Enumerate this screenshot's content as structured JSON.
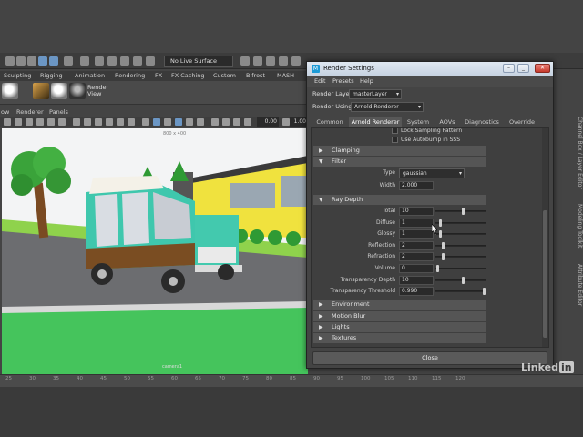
{
  "toolbar": {
    "surface_field": "No Live Surface"
  },
  "shelf": {
    "tabs": [
      "Sculpting",
      "Rigging",
      "Animation",
      "Rendering",
      "FX",
      "FX Caching",
      "Custom",
      "Bifrost",
      "MASH"
    ],
    "render_view_label": "Render View"
  },
  "panel_menu": [
    "ow",
    "Renderer",
    "Panels"
  ],
  "panel_fields": {
    "near": "0.00",
    "far": "1.00"
  },
  "viewport": {
    "resolution_gate": "800 x 400",
    "camera_label": "camera1"
  },
  "timeline": {
    "ticks": [
      "25",
      "30",
      "35",
      "40",
      "45",
      "50",
      "55",
      "60",
      "65",
      "70",
      "75",
      "80",
      "85",
      "90",
      "95",
      "100",
      "105",
      "110",
      "115",
      "120"
    ]
  },
  "side_tabs": [
    "Channel Box / Layer Editor",
    "Modeling Toolkit",
    "Attribute Editor"
  ],
  "render_settings": {
    "title": "Render Settings",
    "menus": [
      "Edit",
      "Presets",
      "Help"
    ],
    "render_layer_label": "Render Layer",
    "render_layer_value": "masterLayer",
    "render_using_label": "Render Using",
    "render_using_value": "Arnold Renderer",
    "tabs": [
      "Common",
      "Arnold Renderer",
      "System",
      "AOVs",
      "Diagnostics",
      "Override"
    ],
    "active_tab": "Arnold Renderer",
    "checkboxes": [
      "Lock Sampling Pattern",
      "Use Autobump in SSS"
    ],
    "sections": {
      "clamping": "Clamping",
      "filter": "Filter",
      "ray_depth": "Ray Depth",
      "environment": "Environment",
      "motion_blur": "Motion Blur",
      "lights": "Lights",
      "textures": "Textures"
    },
    "filter": {
      "type_label": "Type",
      "type_value": "gaussian",
      "width_label": "Width",
      "width_value": "2.000"
    },
    "ray_depth": [
      {
        "label": "Total",
        "value": "10",
        "level": 0.55
      },
      {
        "label": "Diffuse",
        "value": "1",
        "level": 0.08
      },
      {
        "label": "Glossy",
        "value": "1",
        "level": 0.08
      },
      {
        "label": "Reflection",
        "value": "2",
        "level": 0.14
      },
      {
        "label": "Refraction",
        "value": "2",
        "level": 0.14
      },
      {
        "label": "Volume",
        "value": "0",
        "level": 0.02
      },
      {
        "label": "Transparency Depth",
        "value": "10",
        "level": 0.55
      },
      {
        "label": "Transparency Threshold",
        "value": "0.990",
        "level": 0.99
      }
    ],
    "close_label": "Close"
  },
  "watermark": {
    "text": "Linked",
    "suffix": "in"
  }
}
